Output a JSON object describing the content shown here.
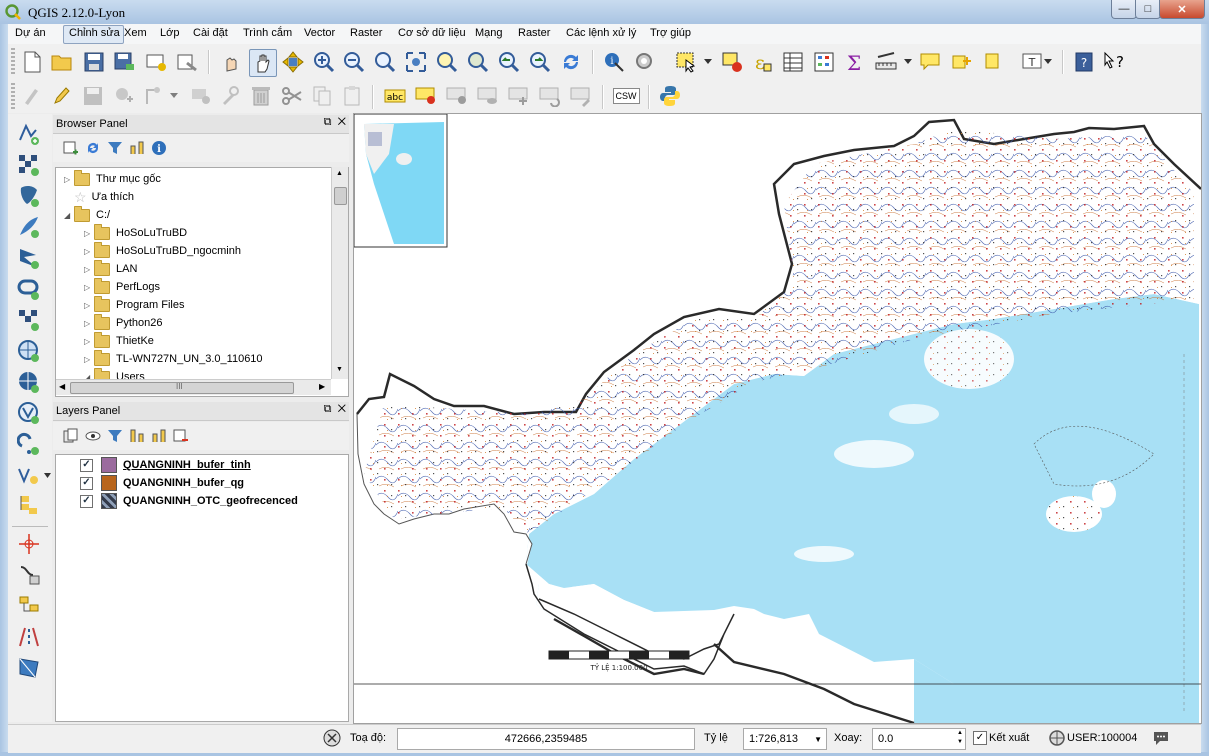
{
  "window": {
    "title": "QGIS 2.12.0-Lyon",
    "minimize_glyph": "—",
    "maximize_glyph": "□",
    "close_glyph": "✕"
  },
  "menu": [
    {
      "label": "Dự án"
    },
    {
      "label": "Chỉnh sửa"
    },
    {
      "label": "Xem"
    },
    {
      "label": "Lớp"
    },
    {
      "label": "Cài đặt"
    },
    {
      "label": "Trình cắm"
    },
    {
      "label": "Vector"
    },
    {
      "label": "Raster"
    },
    {
      "label": "Cơ sở dữ liệu"
    },
    {
      "label": "Mạng"
    },
    {
      "label": "Raster"
    },
    {
      "label": "Các lệnh xử lý"
    },
    {
      "label": "Trợ giúp"
    }
  ],
  "toolbar2": {
    "csw_label": "CSW",
    "label_tool_text": "abc"
  },
  "browser_panel": {
    "title": "Browser Panel",
    "float_glyph": "⧉",
    "close_glyph": "✕",
    "items": [
      {
        "label": "Thư mục gốc"
      },
      {
        "label": "Ưa thích"
      },
      {
        "label": "C:/"
      },
      {
        "label": "HoSoLuTruBD"
      },
      {
        "label": "HoSoLuTruBD_ngocminh"
      },
      {
        "label": "LAN"
      },
      {
        "label": "PerfLogs"
      },
      {
        "label": "Program Files"
      },
      {
        "label": "Python26"
      },
      {
        "label": "ThietKe"
      },
      {
        "label": "TL-WN727N_UN_3.0_110610"
      },
      {
        "label": "Users"
      }
    ],
    "hscroll_grip": "III"
  },
  "layers_panel": {
    "title": "Layers Panel",
    "float_glyph": "⧉",
    "close_glyph": "✕",
    "layers": [
      {
        "name": "QUANGNINH_bufer_tinh",
        "checked": true,
        "color": "#9b6b9e"
      },
      {
        "name": "QUANGNINH_bufer_qg",
        "checked": true,
        "color": "#b8651c"
      },
      {
        "name": "QUANGNINH_OTC_geofrecenced",
        "checked": true,
        "color": "#333a4a"
      }
    ]
  },
  "map": {
    "scalebar_label": "TỶ LỆ 1:100.000",
    "sea_color": "#a8e0f5",
    "land_color": "#ffffff",
    "border_color": "#2a2a2a"
  },
  "status": {
    "coord_label": "Toạ độ:",
    "coord_value": "472666,2359485",
    "scale_label": "Tỷ lệ",
    "scale_value": "1:726,813",
    "rotation_label": "Xoay:",
    "rotation_value": "0.0",
    "render_label": "Kết xuất",
    "render_checked": true,
    "crs_label": "USER:100004"
  }
}
